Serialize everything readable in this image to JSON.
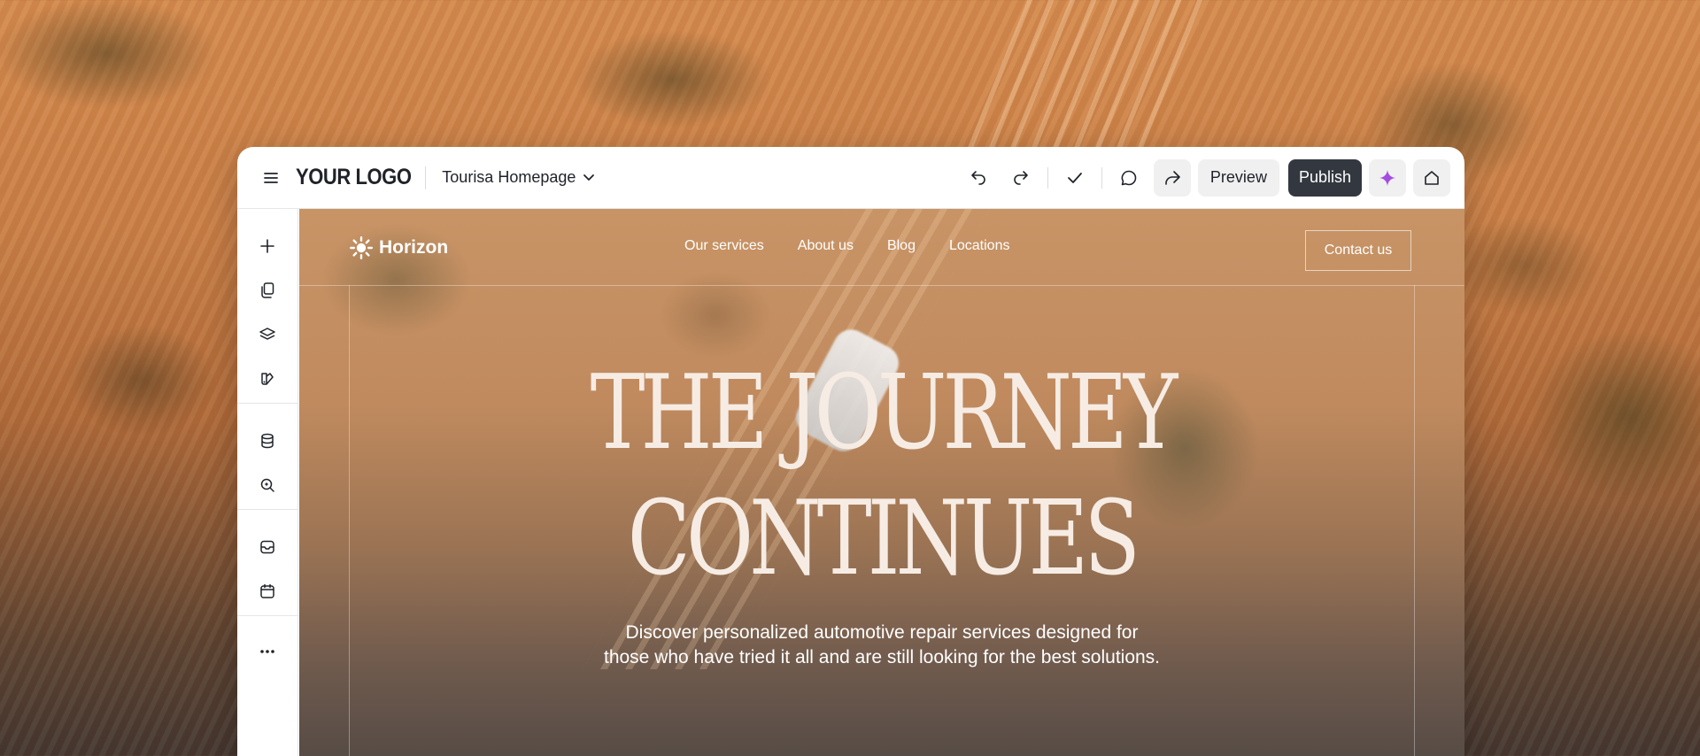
{
  "app": {
    "logo": "YOUR LOGO",
    "page_name": "Tourisa Homepage",
    "preview_label": "Preview",
    "publish_label": "Publish"
  },
  "toolbar_icons": [
    "undo-icon",
    "redo-icon",
    "check-icon",
    "comment-icon",
    "share-icon",
    "sparkle-icon",
    "home-icon"
  ],
  "sidebar_icons": [
    "plus-icon",
    "pages-icon",
    "layers-icon",
    "palette-icon",
    "database-icon",
    "search-icon",
    "media-icon",
    "calendar-icon",
    "more-icon"
  ],
  "site": {
    "brand": "Horizon",
    "nav": [
      "Our services",
      "About us",
      "Blog",
      "Locations"
    ],
    "contact_label": "Contact us",
    "hero_line1": "THE JOURNEY",
    "hero_line2": "CONTINUES",
    "hero_sub_line1": "Discover personalized automotive repair services designed for",
    "hero_sub_line2": "those who have tried it all and are still looking for the best solutions."
  },
  "colors": {
    "publish_bg": "#333840",
    "ai_accent": "#a24de0",
    "hero_text": "#f6ece4"
  }
}
